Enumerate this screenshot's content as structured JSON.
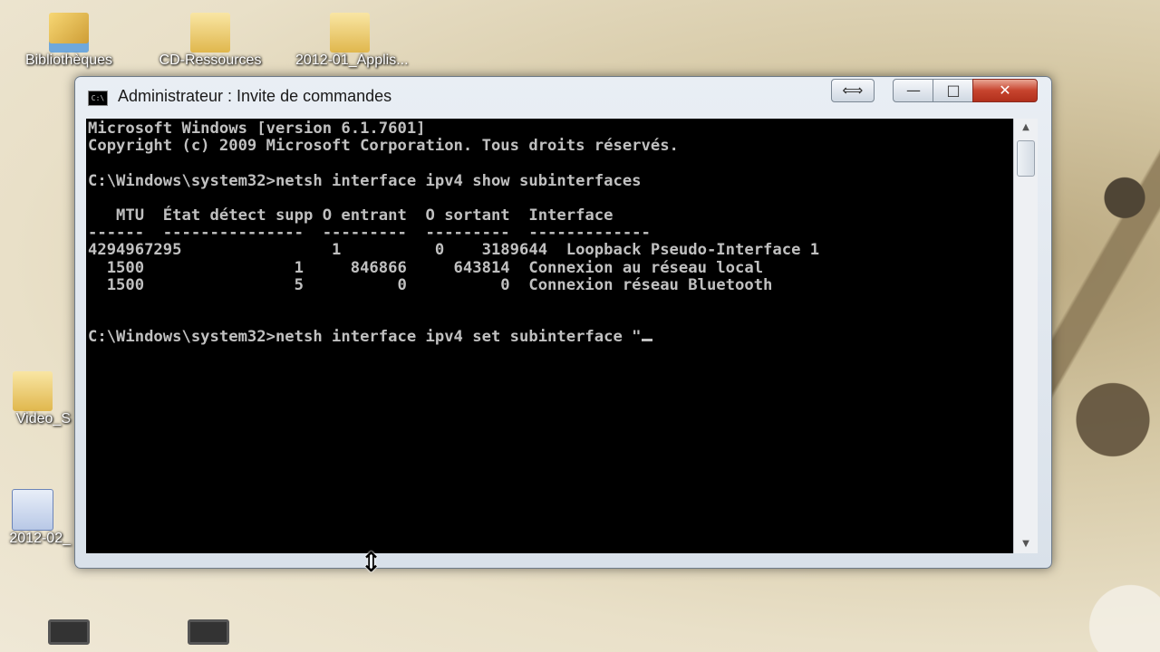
{
  "desktop": {
    "icons": [
      {
        "label": "Bibliothèques"
      },
      {
        "label": "CD-Ressources"
      },
      {
        "label": "2012-01_Applis..."
      },
      {
        "label": "Video_S"
      },
      {
        "label": "2012-02_"
      }
    ]
  },
  "window": {
    "title": "Administrateur : Invite de commandes",
    "icon_text": "C:\\",
    "controls": {
      "resize": "⟺",
      "minimize": "—",
      "maximize": "□",
      "close": "✕"
    }
  },
  "console": {
    "lines": [
      "Microsoft Windows [version 6.1.7601]",
      "Copyright (c) 2009 Microsoft Corporation. Tous droits réservés.",
      "",
      "C:\\Windows\\system32>netsh interface ipv4 show subinterfaces",
      "",
      "   MTU  État détect supp O entrant  O sortant  Interface",
      "------  ---------------  ---------  ---------  -------------",
      "4294967295                1          0    3189644  Loopback Pseudo-Interface 1",
      "  1500                1     846866     643814  Connexion au réseau local",
      "  1500                5          0          0  Connexion réseau Bluetooth",
      "",
      "",
      "C:\\Windows\\system32>netsh interface ipv4 set subinterface \""
    ]
  },
  "scrollbar": {
    "up_arrow": "▲",
    "down_arrow": "▼"
  },
  "cursor": {
    "glyph": "⇕"
  }
}
